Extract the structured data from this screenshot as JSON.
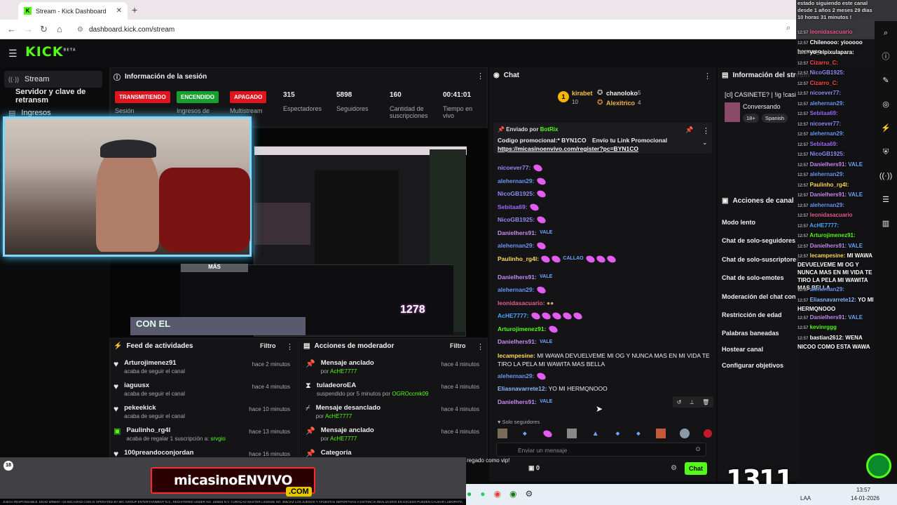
{
  "browser": {
    "tab_title": "Stream - Kick Dashboard",
    "url": "dashboard.kick.com/stream",
    "new_tab": "+",
    "close": "✕"
  },
  "header": {
    "logo": "KICK",
    "logo_badge": "BETA"
  },
  "sidebar": {
    "items": [
      {
        "label": "Stream"
      },
      {
        "label": "Servidor y clave de retransm"
      },
      {
        "label": "Ingresos"
      }
    ]
  },
  "session": {
    "title": "Información de la sesión",
    "badges": [
      {
        "label": "TRANSMITIENDO",
        "caption": "Sesión",
        "color": "#e0141e"
      },
      {
        "label": "ENCENDIDO",
        "caption": "Ingresos de",
        "color": "#18a02e"
      },
      {
        "label": "APAGADO",
        "caption": "Multistream",
        "color": "#e0141e"
      }
    ],
    "stats": [
      {
        "value": "315",
        "label": "Espectadores"
      },
      {
        "value": "5898",
        "label": "Seguidores"
      },
      {
        "value": "160",
        "label": "Cantidad de suscripciones"
      },
      {
        "value": "00:41:01",
        "label": "Tiempo en vivo"
      }
    ]
  },
  "preview": {
    "overlay_text": "MÁS",
    "counter": "1278",
    "subtitle": "CON EL"
  },
  "activity_feed": {
    "title": "Feed de actividades",
    "filter": "Filtro",
    "items": [
      {
        "name": "Arturojimenez91",
        "action": "acaba de seguir el canal",
        "time": "hace 2 minutos",
        "icon": "heart"
      },
      {
        "name": "iaguusx",
        "action": "acaba de seguir el canal",
        "time": "hace 4 minutos",
        "icon": "heart"
      },
      {
        "name": "pekeekick",
        "action": "acaba de seguir el canal",
        "time": "hace 10 minutos",
        "icon": "heart"
      },
      {
        "name": "Paulinho_rg4l",
        "action": "acaba de regalar 1 suscripción a:",
        "target": "srvgio",
        "time": "hace 13 minutos",
        "icon": "gift"
      },
      {
        "name": "100preandoconjordan",
        "action": "",
        "time": "hace 16 minutos",
        "icon": "heart"
      }
    ]
  },
  "mod_actions": {
    "title": "Acciones de moderador",
    "filter": "Filtro",
    "items": [
      {
        "name": "Mensaje anclado",
        "by": "por",
        "user": "AcHE7777",
        "time": "hace 4 minutos",
        "icon": "pin"
      },
      {
        "name": "tuladeoroEA",
        "by": "suspendido por 5 minutos por",
        "user": "OGROccmk09",
        "time": "hace 4 minutos",
        "icon": "hourglass"
      },
      {
        "name": "Mensaje desanclado",
        "by": "por",
        "user": "AcHE7777",
        "time": "hace 4 minutos",
        "icon": "unpin"
      },
      {
        "name": "Mensaje anclado",
        "by": "por",
        "user": "AcHE7777",
        "time": "hace 4 minutos",
        "icon": "pin"
      },
      {
        "name": "Categoría",
        "by": "",
        "user": "",
        "time": "",
        "icon": "pin"
      }
    ]
  },
  "chat": {
    "title": "Chat",
    "top_gifters": [
      {
        "name": "kirabet",
        "count": "10"
      },
      {
        "name": "chanoloko",
        "count": "5"
      },
      {
        "name": "Alexitrico",
        "count": "4"
      }
    ],
    "pinned": {
      "sent_by": "Enviado por",
      "sender": "BotRix",
      "text": "Codigo promocional:* BYN1CO",
      "text2": "Envío tu Link Promocional",
      "link": "https://micasinoenvivo.com/register?pc=BYN1CO"
    },
    "messages": [
      {
        "user": "nicoever77:",
        "color": "#8f8cf2",
        "text": "",
        "emotes": 1
      },
      {
        "user": "alehernan29:",
        "color": "#6b97f5",
        "text": "",
        "emotes": 1
      },
      {
        "user": "NicoGB1925:",
        "color": "#8f8cf2",
        "text": "",
        "emotes": 1
      },
      {
        "user": "Sebitaa69:",
        "color": "#9b6bf5",
        "text": "",
        "emotes": 1
      },
      {
        "user": "NicoGB1925:",
        "color": "#8f8cf2",
        "text": "",
        "emotes": 1
      },
      {
        "user": "Danielhers91:",
        "color": "#c68cf2",
        "text": "VALE",
        "emotes": 0
      },
      {
        "user": "alehernan29:",
        "color": "#6b97f5",
        "text": "",
        "emotes": 1
      },
      {
        "user": "Paulinho_rg4l:",
        "color": "#ffd95a",
        "text": "CALLAO",
        "emotes": 6
      },
      {
        "user": "Danielhers91:",
        "color": "#c68cf2",
        "text": "VALE",
        "emotes": 0
      },
      {
        "user": "alehernan29:",
        "color": "#6b97f5",
        "text": "",
        "emotes": 1
      },
      {
        "user": "leonidasacuario:",
        "color": "#e85c8c",
        "text": "",
        "emotes": 0
      },
      {
        "user": "AcHE7777:",
        "color": "#4aa8ff",
        "text": "",
        "emotes": 5
      },
      {
        "user": "Arturojimenez91:",
        "color": "#53fc18",
        "text": "",
        "emotes": 1
      },
      {
        "user": "Danielhers91:",
        "color": "#c68cf2",
        "text": "VALE",
        "emotes": 0
      },
      {
        "user": "lecampesine:",
        "color": "#ffd95a",
        "text": "MI WAWA DEVUELVEME MI OG Y NUNCA MAS EN MI VIDA TE TIRO LA PELA MI WAWITA MAS BELLA",
        "emotes": 0
      },
      {
        "user": "alehernan29:",
        "color": "#6b97f5",
        "text": "",
        "emotes": 1
      },
      {
        "user": "Eliasnavarrete12:",
        "color": "#8fb8ff",
        "text": "YO MI HERMQNOOO",
        "emotes": 0
      },
      {
        "user": "Danielhers91:",
        "color": "#c68cf2",
        "text": "VALE",
        "emotes": 0
      }
    ],
    "followers_only": "Solo seguidores",
    "input_placeholder": "Enviar un mensaje",
    "points": "0",
    "send_label": "Chat",
    "toast": "regado como vip!"
  },
  "stream_info": {
    "title": "Información del stream",
    "stream_title": "[cl] CASINETE? | !ig !casing",
    "category": "Conversando",
    "tags": [
      "18+",
      "Spanish"
    ]
  },
  "channel_actions": {
    "title": "Acciones de canal",
    "items": [
      "Modo lento",
      "Chat de solo-seguidores",
      "Chat de solo-suscriptores",
      "Chat de solo-emotes",
      "Moderación del chat con IA",
      "Restricción de edad",
      "Palabras baneadas",
      "Hostear canal",
      "Configurar objetivos"
    ]
  },
  "overlay_chat": {
    "header": "estado siguiendo este canal desde 1 años 2 meses 29 días 10 horas 31 minutos !",
    "lines": [
      {
        "time": "12:57",
        "user": "leonidasacuario",
        "text": "",
        "color": "#e85c8c"
      },
      {
        "time": "12:57",
        "user": "Chilenooo:",
        "text": "yiooooo hermano",
        "color": "#fff"
      },
      {
        "time": "12:57",
        "user": "yo_elpixulapara:",
        "text": "",
        "color": "#fff"
      },
      {
        "time": "12:57",
        "user": "Cizarro_C:",
        "text": "",
        "color": "#ff4a4a"
      },
      {
        "time": "12:57",
        "user": "NicoGB1925:",
        "text": "",
        "color": "#8f8cf2"
      },
      {
        "time": "12:57",
        "user": "Cizarro_C:",
        "text": "",
        "color": "#ff4a4a"
      },
      {
        "time": "12:57",
        "user": "nicoever77:",
        "text": "",
        "color": "#8f8cf2"
      },
      {
        "time": "12:57",
        "user": "alehernan29:",
        "text": "",
        "color": "#6b97f5"
      },
      {
        "time": "12:57",
        "user": "Sebitaa69:",
        "text": "",
        "color": "#9b6bf5"
      },
      {
        "time": "12:57",
        "user": "nicoever77:",
        "text": "",
        "color": "#8f8cf2"
      },
      {
        "time": "12:57",
        "user": "alehernan29:",
        "text": "",
        "color": "#6b97f5"
      },
      {
        "time": "12:57",
        "user": "Sebitaa69:",
        "text": "",
        "color": "#9b6bf5"
      },
      {
        "time": "12:57",
        "user": "NicoGB1925:",
        "text": "",
        "color": "#8f8cf2"
      },
      {
        "time": "12:57",
        "user": "Danielhers91:",
        "text": "VALE",
        "color": "#c68cf2"
      },
      {
        "time": "12:57",
        "user": "alehernan29:",
        "text": "",
        "color": "#6b97f5"
      },
      {
        "time": "12:57",
        "user": "Paulinho_rg4l:",
        "text": "",
        "color": "#ffd95a"
      },
      {
        "time": "12:57",
        "user": "Danielhers91:",
        "text": "VALE",
        "color": "#c68cf2"
      },
      {
        "time": "12:57",
        "user": "alehernan29:",
        "text": "",
        "color": "#6b97f5"
      },
      {
        "time": "12:57",
        "user": "leonidasacuario",
        "text": "",
        "color": "#e85c8c"
      },
      {
        "time": "12:57",
        "user": "AcHE7777:",
        "text": "",
        "color": "#4aa8ff"
      },
      {
        "time": "12:57",
        "user": "Arturojimenez91:",
        "text": "",
        "color": "#53fc18"
      },
      {
        "time": "12:57",
        "user": "Danielhers91:",
        "text": "VALE",
        "color": "#c68cf2"
      },
      {
        "time": "12:57",
        "user": "lecampesine:",
        "text": "MI WAWA DEVUELVEME MI OG Y NUNCA MAS EN MI VIDA TE TIRO LA PELA MI WAWITA MAS BELLA",
        "color": "#ffd95a"
      },
      {
        "time": "12:57",
        "user": "alehernan29:",
        "text": "",
        "color": "#6b97f5"
      },
      {
        "time": "12:57",
        "user": "Eliasnavarrete12:",
        "text": "YO MI HERMQNOOO",
        "color": "#8fb8ff"
      },
      {
        "time": "12:57",
        "user": "Danielhers91:",
        "text": "VALE",
        "color": "#c68cf2"
      },
      {
        "time": "12:57",
        "user": "kevinrggg",
        "text": "",
        "color": "#53fc18"
      },
      {
        "time": "12:57",
        "user": "bastian2612:",
        "text": "WENA NICOO COMO ESTA WAWA",
        "color": "#fff"
      }
    ],
    "counter": "1311"
  },
  "ad": {
    "brand": "micasinoENVIVO",
    "domain": ".COM",
    "age": "18",
    "legal": "JUEGA RESPONSABLE. EDAD MÍNIMA +18 MICASINO.COM IS OPERATED BY MIC GROUP ENTERTAINMENT N.V., REGISTERED UNDER NO. 160504 N.V. CURAÇAO MASTER LICENSE NO. 365/JAZ LOS JUEGOS Y APUESTAS DEPORTIVAS A DISTANCIA REALIZADOS EN EXCESO PUEDEN CAUSAR LUDOPATÍA."
  },
  "taskbar": {
    "lang": "LAA",
    "time": "13:57",
    "date": "14-01-2026"
  }
}
